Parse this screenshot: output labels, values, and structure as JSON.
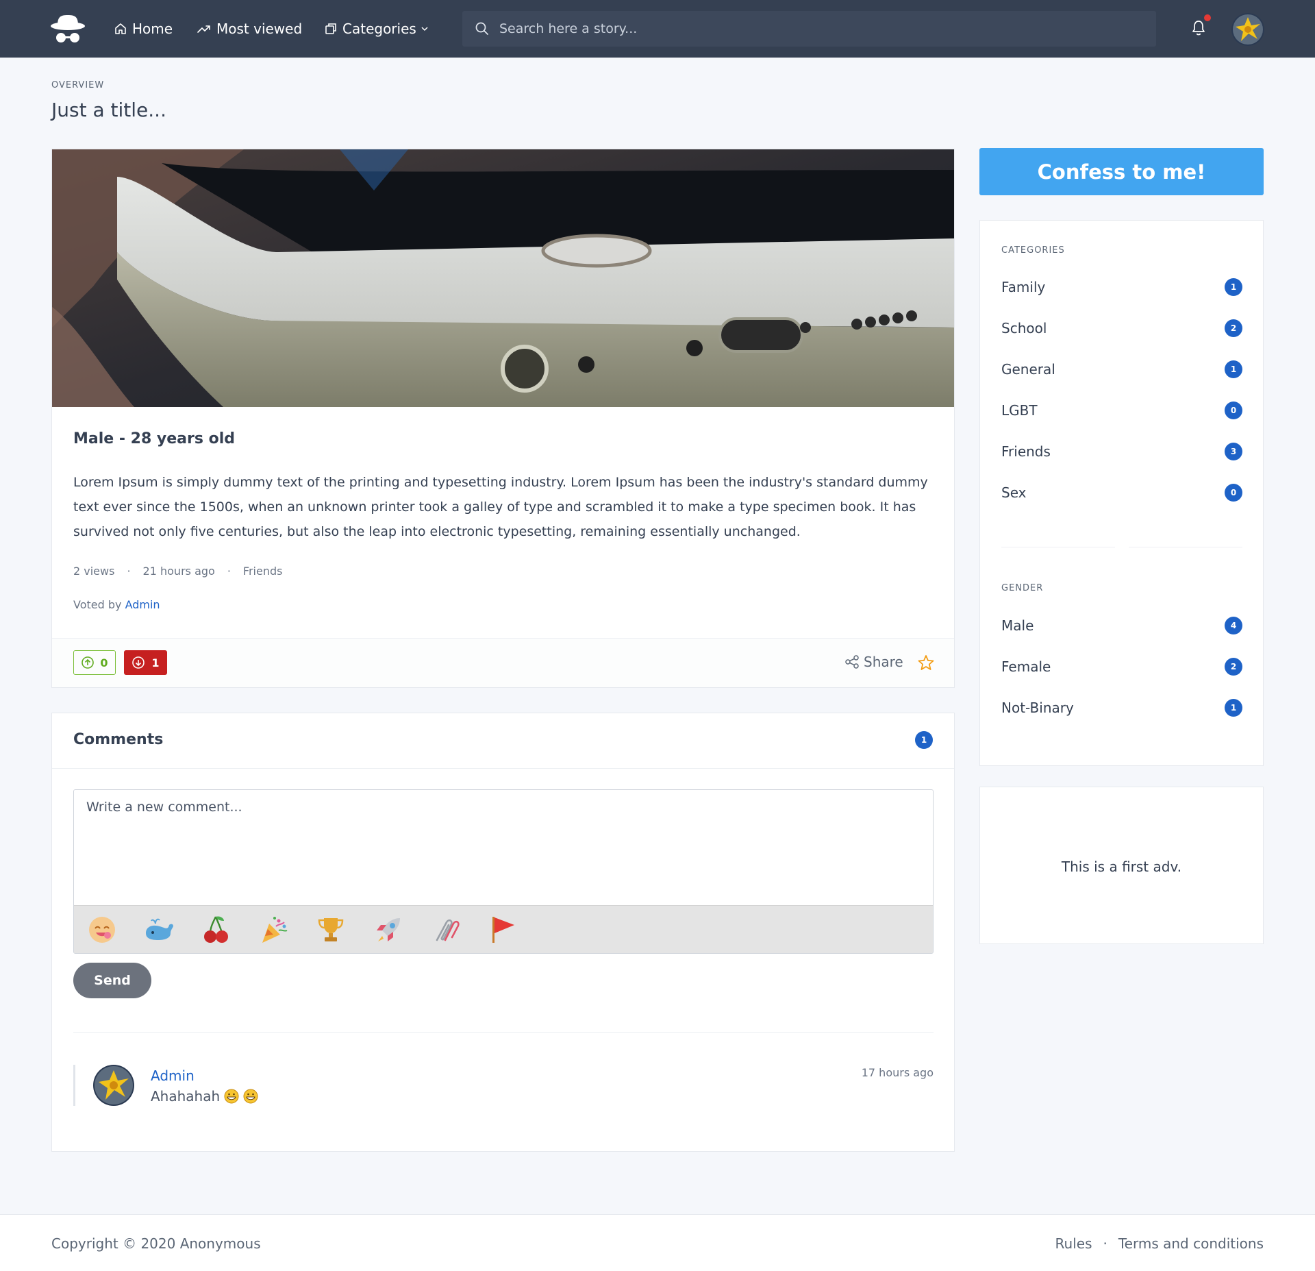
{
  "nav": {
    "home": "Home",
    "most_viewed": "Most viewed",
    "categories": "Categories",
    "search_placeholder": "Search here a story..."
  },
  "header": {
    "overline": "OVERVIEW",
    "title": "Just a title..."
  },
  "post": {
    "heading": "Male - 28 years old",
    "body": "Lorem Ipsum is simply dummy text of the printing and typesetting industry. Lorem Ipsum has been the industry's standard dummy text ever since the 1500s, when an unknown printer took a galley of type and scrambled it to make a type specimen book. It has survived not only five centuries, but also the leap into electronic typesetting, remaining essentially unchanged.",
    "views": "2 views",
    "time": "21 hours ago",
    "category": "Friends",
    "voted_by_label": "Voted by",
    "voted_by_user": "Admin",
    "upvotes": "0",
    "downvotes": "1",
    "share_label": "Share"
  },
  "comments": {
    "title": "Comments",
    "count": "1",
    "placeholder": "Write a new comment...",
    "emoji_icons": [
      "smile-icon",
      "whale-icon",
      "cherries-icon",
      "party-popper-icon",
      "trophy-icon",
      "rocket-icon",
      "paperclip-icon",
      "flag-icon"
    ],
    "send_label": "Send",
    "items": [
      {
        "author": "Admin",
        "text": "Ahahahah",
        "time": "17 hours ago"
      }
    ]
  },
  "sidebar": {
    "confess_label": "Confess to me!",
    "categories_label": "CATEGORIES",
    "categories": [
      {
        "name": "Family",
        "count": "1"
      },
      {
        "name": "School",
        "count": "2"
      },
      {
        "name": "General",
        "count": "1"
      },
      {
        "name": "LGBT",
        "count": "0"
      },
      {
        "name": "Friends",
        "count": "3"
      },
      {
        "name": "Sex",
        "count": "0"
      }
    ],
    "gender_label": "GENDER",
    "genders": [
      {
        "name": "Male",
        "count": "4"
      },
      {
        "name": "Female",
        "count": "2"
      },
      {
        "name": "Not-Binary",
        "count": "1"
      }
    ],
    "ad_text": "This is a first adv."
  },
  "footer": {
    "copyright": "Copyright © 2020 Anonymous",
    "rules": "Rules",
    "terms": "Terms and conditions"
  },
  "colors": {
    "navbar": "#354052",
    "accent_blue": "#1e62c7",
    "confess_button": "#42a5f0",
    "upvote_green": "#5fab1e",
    "downvote_red": "#c62020",
    "star_orange": "#f39c12"
  }
}
